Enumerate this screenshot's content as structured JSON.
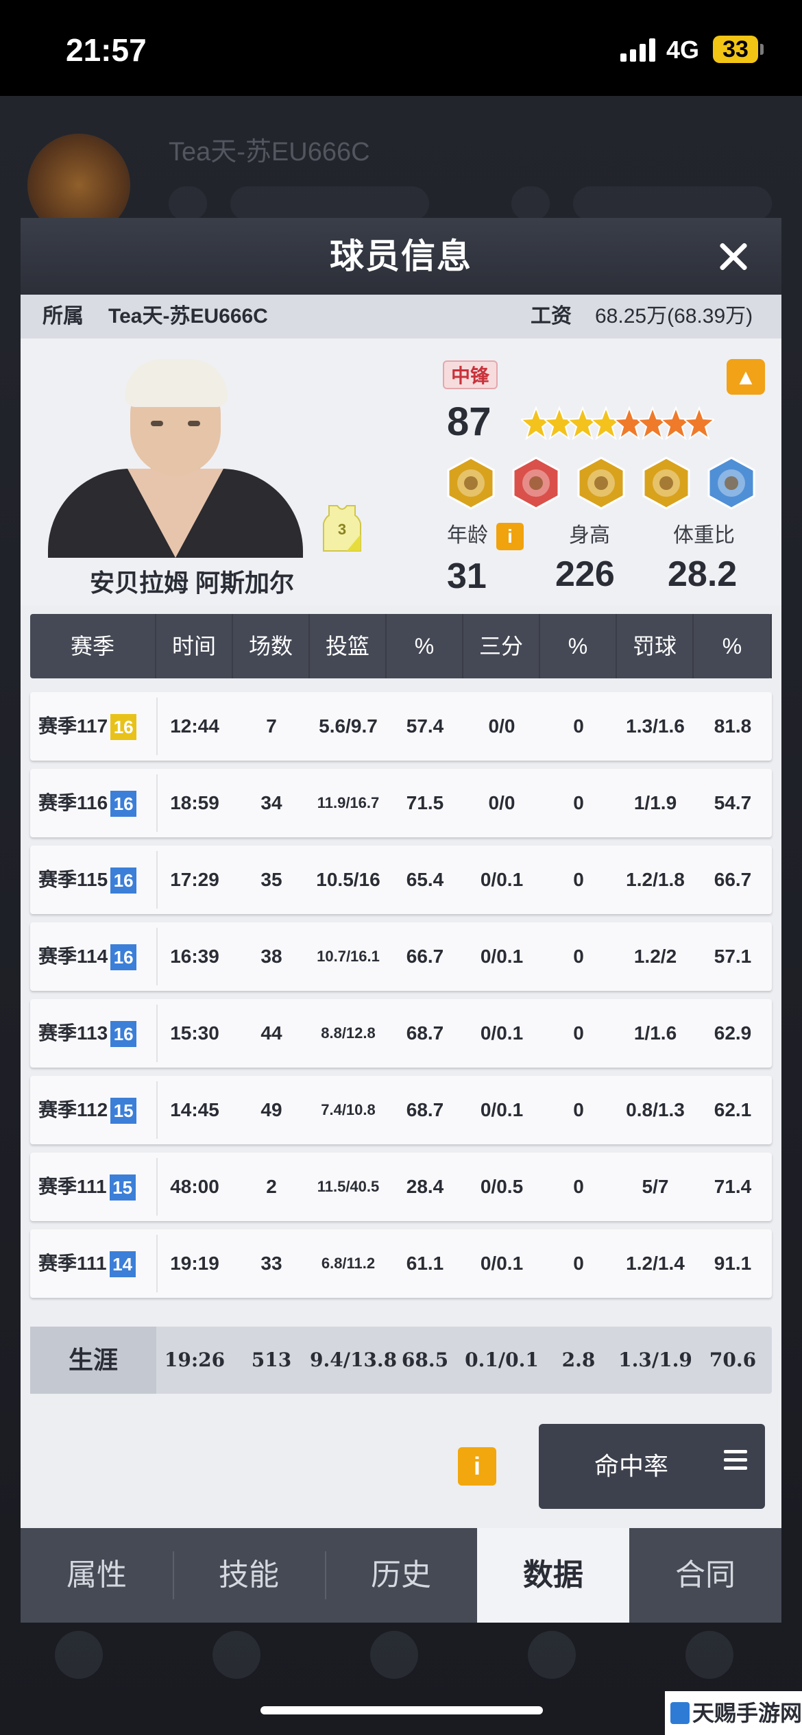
{
  "status_bar": {
    "time": "21:57",
    "network": "4G",
    "battery": "33"
  },
  "background": {
    "team_name": "Tea天-苏EU666C"
  },
  "modal": {
    "title": "球员信息"
  },
  "info_bar": {
    "team_label": "所属",
    "team_value": "Tea天-苏EU666C",
    "salary_label": "工资",
    "salary_value": "68.25万(68.39万)"
  },
  "player": {
    "name": "安贝拉姆 阿斯加尔",
    "jersey_number": "3",
    "position": "中锋",
    "rating": "87",
    "stars": {
      "gold": 4,
      "orange": 4,
      "total": 8
    },
    "age_label": "年龄",
    "age": "31",
    "height_label": "身高",
    "height": "226",
    "weight_ratio_label": "体重比",
    "weight_ratio": "28.2",
    "skill_icons": [
      "post-up-icon",
      "dunk-icon",
      "lightning-icon",
      "block-icon",
      "defender-icon"
    ],
    "skill_colors": [
      "#d9a21c",
      "#d9514a",
      "#d9a21c",
      "#d9a21c",
      "#4f8fd6"
    ]
  },
  "table": {
    "headers": [
      "赛季",
      "时间",
      "场数",
      "投篮",
      "%",
      "三分",
      "%",
      "罚球",
      "%"
    ],
    "rows": [
      {
        "season": "赛季117",
        "lv": "16",
        "lv_color": "#e8c21a",
        "time": "12:44",
        "games": "7",
        "fg": "5.6/9.7",
        "fg_pct": "57.4",
        "three": "0/0",
        "three_pct": "0",
        "ft": "1.3/1.6",
        "ft_pct": "81.8"
      },
      {
        "season": "赛季116",
        "lv": "16",
        "lv_color": "#3b7fd8",
        "time": "18:59",
        "games": "34",
        "fg": "11.9/16.7",
        "fg_pct": "71.5",
        "three": "0/0",
        "three_pct": "0",
        "ft": "1/1.9",
        "ft_pct": "54.7"
      },
      {
        "season": "赛季115",
        "lv": "16",
        "lv_color": "#3b7fd8",
        "time": "17:29",
        "games": "35",
        "fg": "10.5/16",
        "fg_pct": "65.4",
        "three": "0/0.1",
        "three_pct": "0",
        "ft": "1.2/1.8",
        "ft_pct": "66.7"
      },
      {
        "season": "赛季114",
        "lv": "16",
        "lv_color": "#3b7fd8",
        "time": "16:39",
        "games": "38",
        "fg": "10.7/16.1",
        "fg_pct": "66.7",
        "three": "0/0.1",
        "three_pct": "0",
        "ft": "1.2/2",
        "ft_pct": "57.1"
      },
      {
        "season": "赛季113",
        "lv": "16",
        "lv_color": "#3b7fd8",
        "time": "15:30",
        "games": "44",
        "fg": "8.8/12.8",
        "fg_pct": "68.7",
        "three": "0/0.1",
        "three_pct": "0",
        "ft": "1/1.6",
        "ft_pct": "62.9"
      },
      {
        "season": "赛季112",
        "lv": "15",
        "lv_color": "#3b7fd8",
        "time": "14:45",
        "games": "49",
        "fg": "7.4/10.8",
        "fg_pct": "68.7",
        "three": "0/0.1",
        "three_pct": "0",
        "ft": "0.8/1.3",
        "ft_pct": "62.1"
      },
      {
        "season": "赛季111",
        "lv": "15",
        "lv_color": "#3b7fd8",
        "time": "48:00",
        "games": "2",
        "fg": "11.5/40.5",
        "fg_pct": "28.4",
        "three": "0/0.5",
        "three_pct": "0",
        "ft": "5/7",
        "ft_pct": "71.4"
      },
      {
        "season": "赛季111",
        "lv": "14",
        "lv_color": "#3b7fd8",
        "time": "19:19",
        "games": "33",
        "fg": "6.8/11.2",
        "fg_pct": "61.1",
        "three": "0/0.1",
        "three_pct": "0",
        "ft": "1.2/1.4",
        "ft_pct": "91.1"
      }
    ],
    "career": {
      "label": "生涯",
      "time": "19:26",
      "games": "513",
      "fg": "9.4/13.8",
      "fg_pct": "68.5",
      "three": "0.1/0.1",
      "three_pct": "2.8",
      "ft": "1.3/1.9",
      "ft_pct": "70.6"
    }
  },
  "controls": {
    "info_icon": "i",
    "hit_rate_label": "命中率"
  },
  "tabs": [
    {
      "label": "属性",
      "active": false
    },
    {
      "label": "技能",
      "active": false
    },
    {
      "label": "历史",
      "active": false
    },
    {
      "label": "数据",
      "active": true
    },
    {
      "label": "合同",
      "active": false
    }
  ],
  "watermark": "天赐手游网"
}
